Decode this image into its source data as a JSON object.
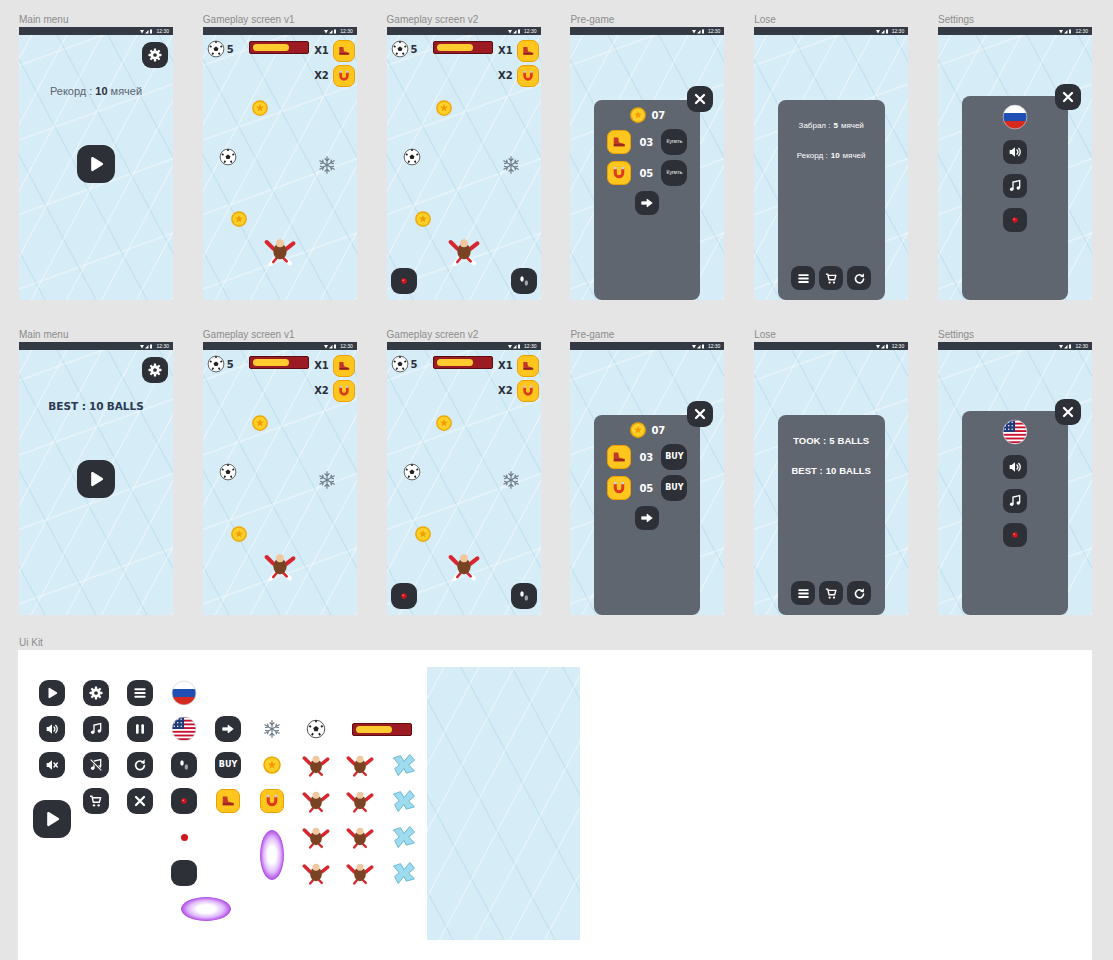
{
  "rows": [
    {
      "kind": "plain",
      "screens": [
        {
          "kind": "main-menu",
          "title": "Main menu",
          "time": "12:30",
          "record": {
            "label": "Рекорд :",
            "value": "10",
            "unit": "мячей"
          }
        },
        {
          "kind": "gameplay",
          "title": "Gameplay screen v1",
          "time": "12:30",
          "balls": "5",
          "energy": 0.7,
          "controls": false,
          "multipliers": [
            {
              "label": "X1",
              "kind": "boots"
            },
            {
              "label": "X2",
              "kind": "magnet"
            }
          ]
        },
        {
          "kind": "gameplay",
          "title": "Gameplay screen v2",
          "time": "12:30",
          "balls": "5",
          "energy": 0.7,
          "controls": true,
          "multipliers": [
            {
              "label": "X1",
              "kind": "boots"
            },
            {
              "label": "X2",
              "kind": "magnet"
            }
          ]
        },
        {
          "kind": "pregame",
          "title": "Pre-game",
          "time": "12:30",
          "coins": "07",
          "boosts": [
            {
              "kind": "boots",
              "count": "03",
              "buy": "Купить"
            },
            {
              "kind": "magnet",
              "count": "05",
              "buy": "Купить"
            }
          ]
        },
        {
          "kind": "lose",
          "title": "Lose",
          "time": "12:30",
          "lines": [
            {
              "label": "Забрал :",
              "value": "5",
              "unit": "мячей"
            },
            {
              "label": "Рекорд :",
              "value": "10",
              "unit": "мячей"
            }
          ]
        },
        {
          "kind": "settings",
          "title": "Settings",
          "time": "12:30",
          "flag": "ru"
        }
      ]
    },
    {
      "kind": "display",
      "screens": [
        {
          "kind": "main-menu",
          "title": "Main menu",
          "time": "12:30",
          "record": {
            "label": "BEST :",
            "value": "10",
            "unit": "BALLS"
          }
        },
        {
          "kind": "gameplay",
          "title": "Gameplay screen v1",
          "time": "12:30",
          "balls": "5",
          "energy": 0.7,
          "controls": false,
          "multipliers": [
            {
              "label": "X1",
              "kind": "boots"
            },
            {
              "label": "X2",
              "kind": "magnet"
            }
          ]
        },
        {
          "kind": "gameplay",
          "title": "Gameplay screen v2",
          "time": "12:30",
          "balls": "5",
          "energy": 0.7,
          "controls": true,
          "multipliers": [
            {
              "label": "X1",
              "kind": "boots"
            },
            {
              "label": "X2",
              "kind": "magnet"
            }
          ]
        },
        {
          "kind": "pregame",
          "title": "Pre-game",
          "time": "12:30",
          "coins": "07",
          "boosts": [
            {
              "kind": "boots",
              "count": "03",
              "buy": "BUY"
            },
            {
              "kind": "magnet",
              "count": "05",
              "buy": "BUY"
            }
          ]
        },
        {
          "kind": "lose",
          "title": "Lose",
          "time": "12:30",
          "lines": [
            {
              "label": "TOOK :",
              "value": "5",
              "unit": "BALLS"
            },
            {
              "label": "BEST :",
              "value": "10",
              "unit": "BALLS"
            }
          ]
        },
        {
          "kind": "settings",
          "title": "Settings",
          "time": "12:30",
          "flag": "us"
        }
      ]
    }
  ],
  "ui_kit": {
    "title": "Ui Kit",
    "buy": "BUY",
    "energy": 0.7
  }
}
